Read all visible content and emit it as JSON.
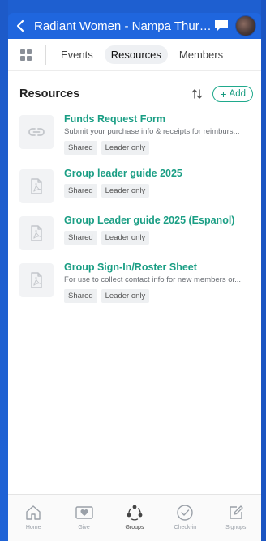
{
  "header": {
    "title": "Radiant Women - Nampa Thursd...",
    "back_icon": "chevron-left-icon",
    "chat_icon": "chat-bubble-icon",
    "avatar_icon": "user-avatar"
  },
  "tabs": {
    "items": [
      {
        "label": "Events",
        "active": false
      },
      {
        "label": "Resources",
        "active": true
      },
      {
        "label": "Members",
        "active": false
      }
    ]
  },
  "resources": {
    "title": "Resources",
    "add_label": "Add",
    "items": [
      {
        "icon": "link-icon",
        "title": "Funds Request Form",
        "description": "Submit your purchase info & receipts for reimburs...",
        "tags": [
          "Shared",
          "Leader only"
        ]
      },
      {
        "icon": "pdf-file-icon",
        "title": "Group leader guide 2025",
        "description": "",
        "tags": [
          "Shared",
          "Leader only"
        ]
      },
      {
        "icon": "pdf-file-icon",
        "title": "Group Leader guide 2025 (Espanol)",
        "description": "",
        "tags": [
          "Shared",
          "Leader only"
        ]
      },
      {
        "icon": "pdf-file-icon",
        "title": "Group Sign-In/Roster Sheet",
        "description": "For use to collect contact info for new members or...",
        "tags": [
          "Shared",
          "Leader only"
        ]
      }
    ]
  },
  "bottom_nav": {
    "items": [
      {
        "label": "Home",
        "icon": "home-icon",
        "active": false
      },
      {
        "label": "Give",
        "icon": "give-heart-icon",
        "active": false
      },
      {
        "label": "Groups",
        "icon": "groups-icon",
        "active": true
      },
      {
        "label": "Check-in",
        "icon": "check-circle-icon",
        "active": false
      },
      {
        "label": "Signups",
        "icon": "edit-square-icon",
        "active": false
      }
    ]
  },
  "colors": {
    "header_bg": "#1f66de",
    "accent": "#1a9e84",
    "frame_bg": "#1e5fd0"
  }
}
